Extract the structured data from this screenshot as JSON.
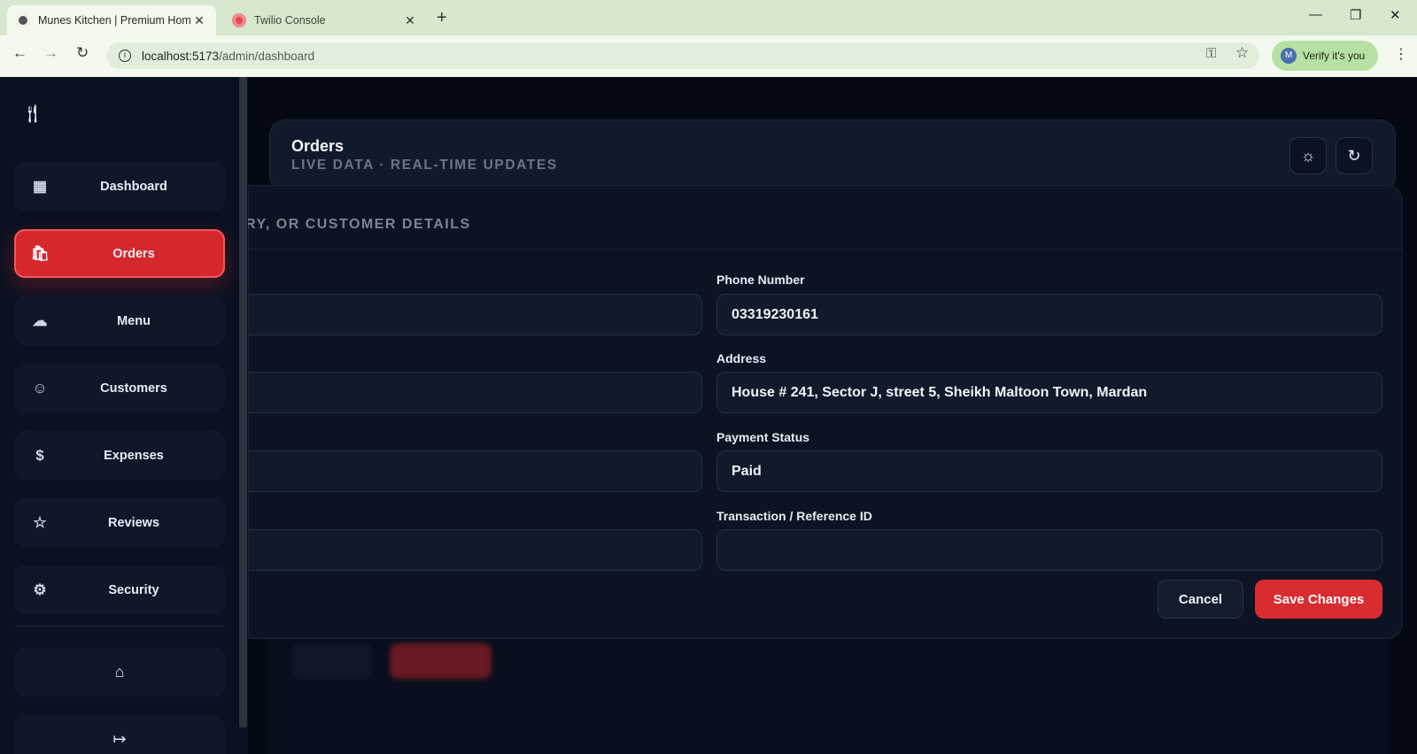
{
  "browser": {
    "tabs": [
      {
        "title": "Munes Kitchen | Premium Home",
        "close": "✕"
      },
      {
        "title": "Twilio Console",
        "close": "✕"
      }
    ],
    "new_tab": "+",
    "url_host": "localhost:5173",
    "url_path": "/admin/dashboard",
    "verify_label": "Verify it's you",
    "avatar_letter": "M"
  },
  "sidebar": {
    "items": [
      {
        "label": "Dashboard",
        "icon": "grid-icon"
      },
      {
        "label": "Orders",
        "icon": "shopping-bag-icon"
      },
      {
        "label": "Menu",
        "icon": "chef-hat-icon"
      },
      {
        "label": "Customers",
        "icon": "users-icon"
      },
      {
        "label": "Expenses",
        "icon": "dollar-icon"
      },
      {
        "label": "Reviews",
        "icon": "star-icon"
      },
      {
        "label": "Security",
        "icon": "gear-icon"
      }
    ],
    "active": "Orders"
  },
  "header": {
    "title": "Orders",
    "subtitle": "LIVE DATA · REAL-TIME UPDATES"
  },
  "modal": {
    "section_title": "RY, OR CUSTOMER DETAILS",
    "phone_label": "Phone Number",
    "phone_value": "03319230161",
    "address_label": "Address",
    "address_value": "House # 241, Sector J, street 5, Sheikh Maltoon Town, Mardan",
    "payment_status_label": "Payment Status",
    "payment_status_value": "Paid",
    "transaction_label": "Transaction / Reference ID",
    "transaction_value": "",
    "cancel_label": "Cancel",
    "save_label": "Save Changes"
  },
  "colors": {
    "accent": "#d82c31",
    "background": "#040914",
    "panel": "#0c1423"
  }
}
